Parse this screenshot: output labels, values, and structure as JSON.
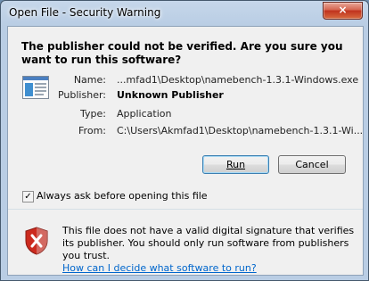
{
  "window": {
    "title": "Open File - Security Warning",
    "close_symbol": "×"
  },
  "headline": "The publisher could not be verified.  Are you sure you want to run this software?",
  "details": [
    {
      "label": "Name:",
      "value": "...mfad1\\Desktop\\namebench-1.3.1-Windows.exe",
      "bold": false
    },
    {
      "label": "Publisher:",
      "value": "Unknown Publisher",
      "bold": true
    },
    {
      "label": "Type:",
      "value": "Application",
      "bold": false
    },
    {
      "label": "From:",
      "value": "C:\\Users\\Akmfad1\\Desktop\\namebench-1.3.1-Wi...",
      "bold": false
    }
  ],
  "buttons": {
    "run_label": "Run",
    "cancel_label": "Cancel"
  },
  "always_ask": {
    "label": "Always ask before opening this file",
    "checked": true
  },
  "warning": {
    "text": "This file does not have a valid digital signature that verifies its publisher.  You should only run software from publishers you trust.",
    "link": "How can I decide what software to run?"
  },
  "icons": {
    "file_icon": "application-file-icon",
    "shield_icon": "security-shield-icon"
  },
  "colors": {
    "link": "#0066cc",
    "shield_red": "#cc2a1e",
    "title_bar": "#c6d7ea"
  }
}
